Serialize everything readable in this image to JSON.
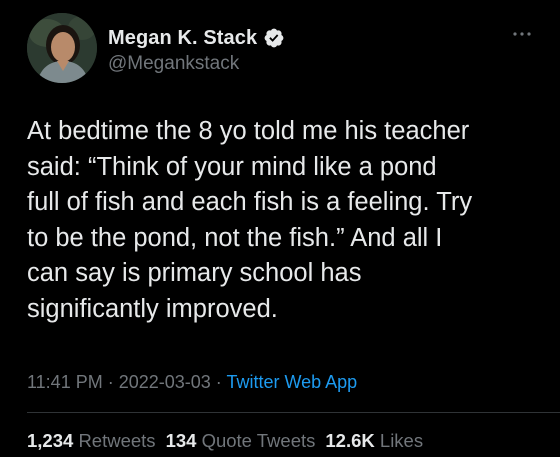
{
  "author": {
    "display_name": "Megan K. Stack",
    "handle": "@Megankstack",
    "verified": true,
    "avatar_icon": "profile-photo"
  },
  "tweet": {
    "text": "At bedtime the 8 yo told me his teacher\nsaid: “Think of your mind like a pond\nfull of fish and each fish is a feeling. Try\nto be the pond, not the fish.” And all I\ncan say is primary school has\nsignificantly improved."
  },
  "meta": {
    "time": "11:41 PM",
    "separator": " · ",
    "date": "2022-03-03",
    "app": "Twitter Web App"
  },
  "stats": {
    "retweets_count": "1,234",
    "retweets_label": "Retweets",
    "quotes_count": "134",
    "quotes_label": "Quote Tweets",
    "likes_count": "12.6K",
    "likes_label": "Likes"
  },
  "colors": {
    "background": "#000000",
    "text_primary": "#e7e9ea",
    "text_secondary": "#71767b",
    "link": "#1d9bf0",
    "divider": "#2f3336"
  },
  "icons": {
    "verified": "verified-badge-icon",
    "more": "more-options-icon"
  }
}
